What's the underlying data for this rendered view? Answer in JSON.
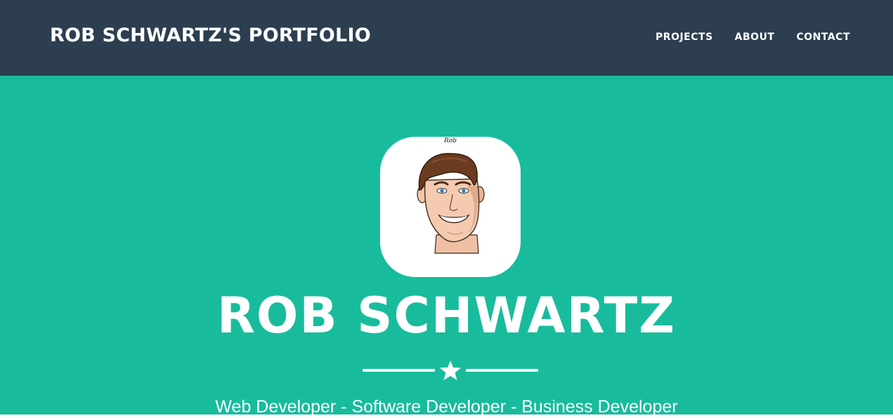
{
  "navbar": {
    "brand": "ROB SCHWARTZ'S PORTFOLIO",
    "links": [
      {
        "label": "PROJECTS"
      },
      {
        "label": "ABOUT"
      },
      {
        "label": "CONTACT"
      }
    ]
  },
  "hero": {
    "avatar_caption": "Rob",
    "name": "ROB SCHWARTZ",
    "divider_icon": "star-icon",
    "tagline": "Web Developer - Software Developer - Business Developer"
  },
  "colors": {
    "navbar_bg": "#2c3e50",
    "hero_bg": "#18bc9c",
    "text": "#ffffff"
  }
}
